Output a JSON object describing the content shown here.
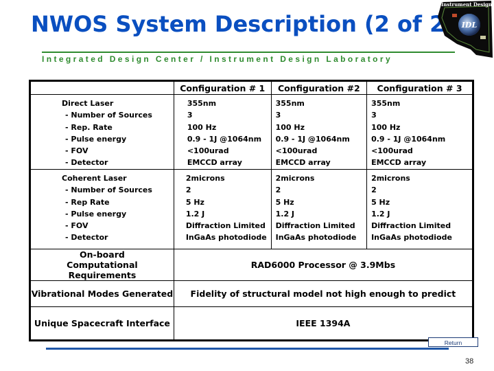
{
  "header": {
    "title": "NWOS System Description (2 of 2)",
    "subtitle": "Integrated Design Center / Instrument Design Laboratory",
    "logo": {
      "icon": "idl-logo-icon",
      "top_text": "Instrument Design",
      "center_text": "IDL"
    }
  },
  "table": {
    "columns": [
      "",
      "Configuration # 1",
      "Configuration #2",
      "Configuration # 3"
    ],
    "direct_laser": {
      "labels": [
        "Direct Laser",
        "- Number of Sources",
        "- Rep. Rate",
        "- Pulse energy",
        "- FOV",
        "- Detector"
      ],
      "configs": [
        [
          "355nm",
          "3",
          "100 Hz",
          "0.9 - 1J @1064nm",
          "<100urad",
          "EMCCD array"
        ],
        [
          "355nm",
          "3",
          "100 Hz",
          "0.9 - 1J @1064nm",
          "<100urad",
          "EMCCD array"
        ],
        [
          "355nm",
          "3",
          "100 Hz",
          "0.9 - 1J @1064nm",
          "<100urad",
          "EMCCD array"
        ]
      ]
    },
    "coherent_laser": {
      "labels": [
        "Coherent Laser",
        "- Number of Sources",
        "- Rep Rate",
        "- Pulse energy",
        "- FOV",
        "- Detector"
      ],
      "configs": [
        [
          "2microns",
          "2",
          "5 Hz",
          "1.2 J",
          "Diffraction Limited",
          "InGaAs photodiode"
        ],
        [
          "2microns",
          "2",
          "5 Hz",
          "1.2 J",
          "Diffraction Limited",
          "InGaAs photodiode"
        ],
        [
          "2microns",
          "2",
          "5 Hz",
          "1.2 J",
          "Diffraction Limited",
          "InGaAs photodiode"
        ]
      ]
    },
    "spanning_rows": [
      {
        "label": "On-board Computational Requirements",
        "value": "RAD6000 Processor @ 3.9Mbs"
      },
      {
        "label": "Vibrational Modes Generated",
        "value": "Fidelity of structural model not high enough to predict"
      },
      {
        "label": "Unique Spacecraft Interface",
        "value": "IEEE 1394A"
      }
    ]
  },
  "footer": {
    "return_label": "Return",
    "page_number": "38"
  },
  "colors": {
    "title": "#0a4fc0",
    "subtitle": "#2e8b2e",
    "rule_green": "#2e8b2e",
    "rule_blue": "#1f57a8"
  }
}
